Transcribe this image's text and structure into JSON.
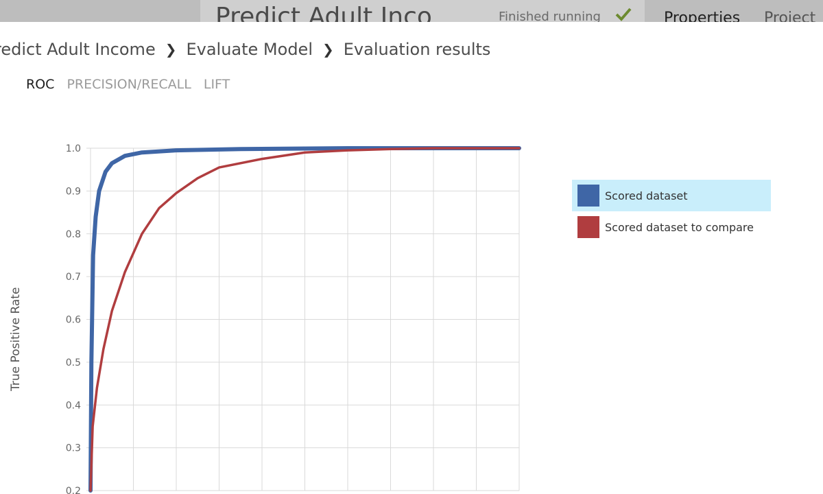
{
  "background": {
    "title": "Predict Adult Inco",
    "status": "Finished running",
    "tabs": [
      "Properties",
      "Project"
    ]
  },
  "breadcrumb": [
    "redict Adult Income",
    "Evaluate Model",
    "Evaluation results"
  ],
  "tabs": [
    {
      "label": "ROC",
      "active": true
    },
    {
      "label": "PRECISION/RECALL",
      "active": false
    },
    {
      "label": "LIFT",
      "active": false
    }
  ],
  "chart_data": {
    "type": "line",
    "title": "",
    "xlabel": "",
    "ylabel": "True Positive Rate",
    "xlim": [
      0,
      1
    ],
    "ylim": [
      0.2,
      1.0
    ],
    "yticks": [
      "0.2",
      "0.3",
      "0.4",
      "0.5",
      "0.6",
      "0.7",
      "0.8",
      "0.9",
      "1.0"
    ],
    "grid": true,
    "legend_position": "right",
    "series": [
      {
        "name": "Scored dataset",
        "color": "#3f66a6",
        "x": [
          0.0,
          0.002,
          0.006,
          0.012,
          0.02,
          0.035,
          0.05,
          0.08,
          0.12,
          0.2,
          0.35,
          0.6,
          1.0
        ],
        "y": [
          0.2,
          0.5,
          0.75,
          0.84,
          0.9,
          0.945,
          0.965,
          0.982,
          0.99,
          0.995,
          0.998,
          1.0,
          1.0
        ]
      },
      {
        "name": "Scored dataset to compare",
        "color": "#b03d3f",
        "x": [
          0.0,
          0.005,
          0.015,
          0.03,
          0.05,
          0.08,
          0.12,
          0.16,
          0.2,
          0.25,
          0.3,
          0.4,
          0.5,
          0.6,
          0.7,
          0.8,
          1.0
        ],
        "y": [
          0.2,
          0.35,
          0.44,
          0.53,
          0.62,
          0.71,
          0.8,
          0.86,
          0.895,
          0.93,
          0.955,
          0.975,
          0.99,
          0.995,
          0.998,
          1.0,
          1.0
        ]
      }
    ]
  }
}
